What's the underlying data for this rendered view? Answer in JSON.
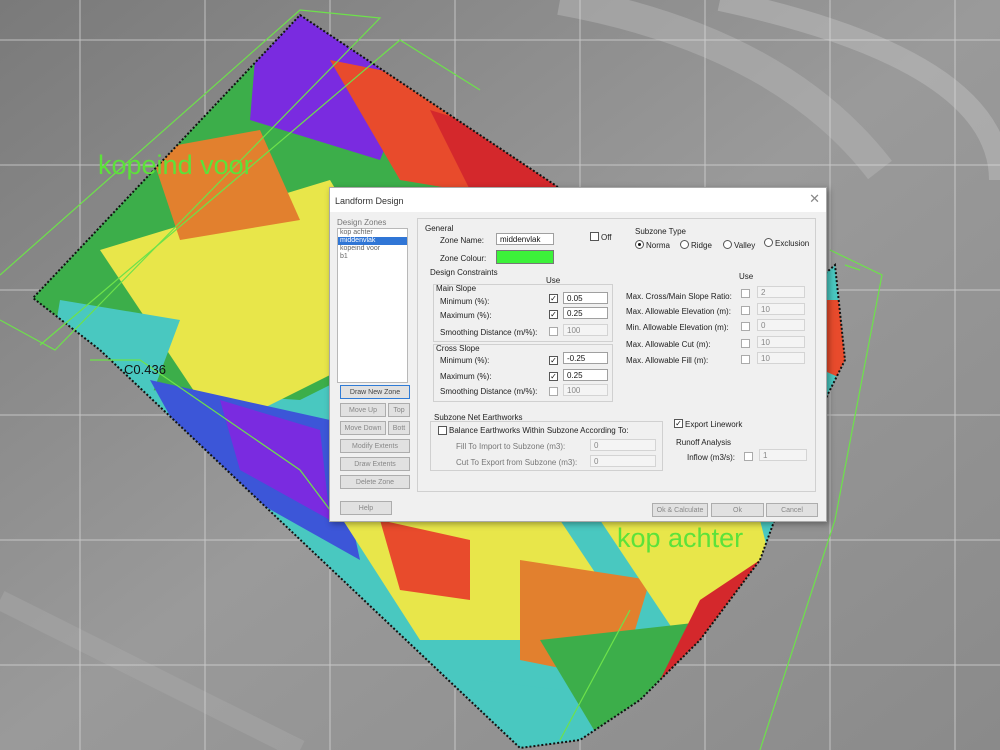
{
  "map": {
    "label_front": "kopeind voor",
    "label_back": "kop achter",
    "value_label": "C0.436"
  },
  "dialog": {
    "title": "Landform Design",
    "close_glyph": "✕",
    "design_zones": {
      "heading": "Design Zones",
      "items": [
        "kop achter",
        "middenvlak",
        "kopeind voor",
        "b1"
      ],
      "selected": "middenvlak"
    },
    "zone_buttons": {
      "draw_new_zone": "Draw New Zone",
      "move_up": "Move Up",
      "top": "Top",
      "move_down": "Move Down",
      "bottom": "Bott",
      "modify_extents": "Modify Extents",
      "draw_extents": "Draw Extents",
      "delete_zone": "Delete Zone",
      "help": "Help"
    },
    "general": {
      "heading": "General",
      "zone_name_label": "Zone Name:",
      "zone_name_value": "middenvlak",
      "off_label": "Off",
      "zone_colour_label": "Zone Colour:",
      "zone_colour": "#3cf23a"
    },
    "subzone_type": {
      "heading": "Subzone Type",
      "options": [
        "Norma",
        "Ridge",
        "Valley",
        "Exclusion"
      ],
      "selected": "Norma"
    },
    "design_constraints": {
      "heading": "Design Constraints",
      "use_label": "Use",
      "main_slope": {
        "heading": "Main Slope",
        "minimum_label": "Minimum (%):",
        "minimum_value": "0.05",
        "maximum_label": "Maximum (%):",
        "maximum_value": "0.25",
        "smoothing_label": "Smoothing Distance (m/%):",
        "smoothing_value": "100"
      },
      "cross_slope": {
        "heading": "Cross Slope",
        "minimum_label": "Minimum (%):",
        "minimum_value": "-0.25",
        "maximum_label": "Maximum (%):",
        "maximum_value": "0.25",
        "smoothing_label": "Smoothing Distance (m/%):",
        "smoothing_value": "100"
      }
    },
    "limits": {
      "use_label": "Use",
      "rows": [
        {
          "label": "Max. Cross/Main Slope Ratio:",
          "value": "2"
        },
        {
          "label": "Max. Allowable Elevation (m):",
          "value": "10"
        },
        {
          "label": "Min. Allowable Elevation (m):",
          "value": "0"
        },
        {
          "label": "Max. Allowable Cut (m):",
          "value": "10"
        },
        {
          "label": "Max. Allowable Fill (m):",
          "value": "10"
        }
      ]
    },
    "earthworks": {
      "heading": "Subzone Net Earthworks",
      "balance_label": "Balance Earthworks Within Subzone According To:",
      "fill_label": "Fill To Import to Subzone (m3):",
      "fill_value": "0",
      "cut_label": "Cut To Export from Subzone (m3):",
      "cut_value": "0"
    },
    "export_linework_label": "Export Linework",
    "runoff": {
      "heading": "Runoff Analysis",
      "inflow_label": "Inflow (m3/s):",
      "inflow_value": "1"
    },
    "footer": {
      "ok_calculate": "Ok & Calculate",
      "ok": "Ok",
      "cancel": "Cancel"
    }
  }
}
